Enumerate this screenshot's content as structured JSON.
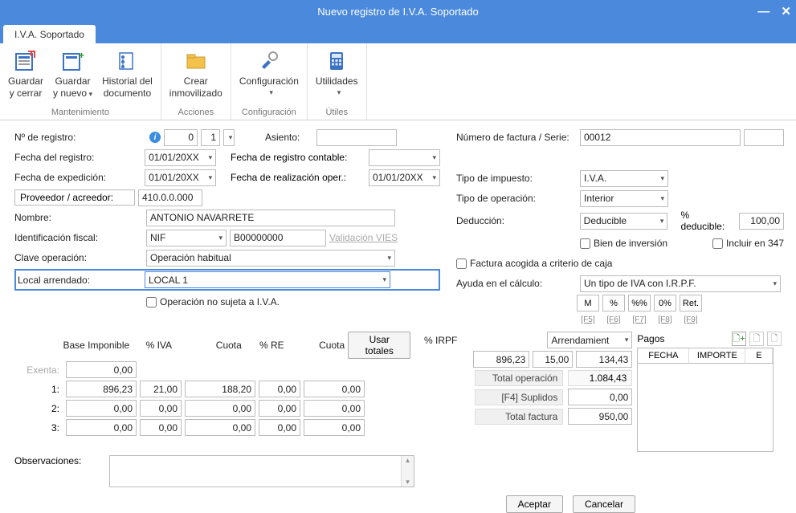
{
  "window": {
    "title": "Nuevo registro de I.V.A. Soportado"
  },
  "tab": {
    "label": "I.V.A. Soportado"
  },
  "ribbon": {
    "groups": [
      {
        "label": "Mantenimiento",
        "items": [
          {
            "label1": "Guardar",
            "label2": "y cerrar"
          },
          {
            "label1": "Guardar",
            "label2": "y nuevo",
            "dd": true
          },
          {
            "label1": "Historial del",
            "label2": "documento"
          }
        ]
      },
      {
        "label": "Acciones",
        "items": [
          {
            "label1": "Crear",
            "label2": "inmovilizado"
          }
        ]
      },
      {
        "label": "Configuración",
        "items": [
          {
            "label1": "Configuración",
            "label2": "",
            "dd": true
          }
        ]
      },
      {
        "label": "Útiles",
        "items": [
          {
            "label1": "Utilidades",
            "label2": "",
            "dd": true
          }
        ]
      }
    ]
  },
  "left": {
    "nregistro_label": "Nº de registro:",
    "nregistro_a": "0",
    "nregistro_b": "1",
    "asiento_label": "Asiento:",
    "fecha_reg_label": "Fecha del registro:",
    "fecha_reg": "01/01/20XX",
    "fecha_reg_cont_label": "Fecha de registro contable:",
    "fecha_exp_label": "Fecha de expedición:",
    "fecha_exp": "01/01/20XX",
    "fecha_real_label": "Fecha de realización oper.:",
    "fecha_real": "01/01/20XX",
    "prov_label": "Proveedor / acreedor:",
    "prov": "410.0.0.000",
    "nombre_label": "Nombre:",
    "nombre": "ANTONIO NAVARRETE",
    "idfiscal_label": "Identificación fiscal:",
    "idfiscal_tipo": "NIF",
    "idfiscal_num": "B00000000",
    "vies": "Validación VIES",
    "clave_label": "Clave operación:",
    "clave": "Operación habitual",
    "local_label": "Local arrendado:",
    "local": "LOCAL 1",
    "no_sujeta": "Operación no sujeta a I.V.A."
  },
  "right": {
    "nfact_label": "Número de factura / Serie:",
    "nfact": "00012",
    "tipo_imp_label": "Tipo de impuesto:",
    "tipo_imp": "I.V.A.",
    "tipo_op_label": "Tipo de operación:",
    "tipo_op": "Interior",
    "deduccion_label": "Deducción:",
    "deduccion": "Deducible",
    "pct_ded_label": "% deducible:",
    "pct_ded": "100,00",
    "bien_inv": "Bien de inversión",
    "incluir347": "Incluir en 347",
    "factura_caja": "Factura acogida a criterio de caja",
    "ayuda_label": "Ayuda en el cálculo:",
    "ayuda": "Un tipo de IVA con I.R.P.F.",
    "calc": [
      "M",
      "%",
      "%%",
      "0%",
      "Ret."
    ],
    "calc_keys": [
      "[F5]",
      "[F6]",
      "[F7]",
      "[F8]",
      "[F9]"
    ]
  },
  "grid": {
    "headers": {
      "base": "Base Imponible",
      "pctiva": "% IVA",
      "cuota": "Cuota",
      "pctre": "% RE",
      "cuota2": "Cuota",
      "usar": "Usar totales",
      "pctirpf": "% IRPF",
      "arr": "Arrendamient"
    },
    "exenta_label": "Exenta:",
    "exenta_val": "0,00",
    "rows": [
      {
        "n": "1:",
        "base": "896,23",
        "pctiva": "21,00",
        "cuota": "188,20",
        "pctre": "0,00",
        "cuota2": "0,00"
      },
      {
        "n": "2:",
        "base": "0,00",
        "pctiva": "0,00",
        "cuota": "0,00",
        "pctre": "0,00",
        "cuota2": "0,00"
      },
      {
        "n": "3:",
        "base": "0,00",
        "pctiva": "0,00",
        "cuota": "0,00",
        "pctre": "0,00",
        "cuota2": "0,00"
      }
    ],
    "irpf": {
      "base": "896,23",
      "pct": "15,00",
      "cuota": "134,43"
    },
    "totals": {
      "op_label": "Total operación",
      "op": "1.084,43",
      "sup_label": "[F4] Suplidos",
      "sup": "0,00",
      "fact_label": "Total factura",
      "fact": "950,00"
    },
    "pagos": {
      "title": "Pagos",
      "cols": [
        "FECHA",
        "IMPORTE",
        "E"
      ]
    },
    "obs_label": "Observaciones:"
  },
  "footer": {
    "aceptar": "Aceptar",
    "cancelar": "Cancelar"
  }
}
